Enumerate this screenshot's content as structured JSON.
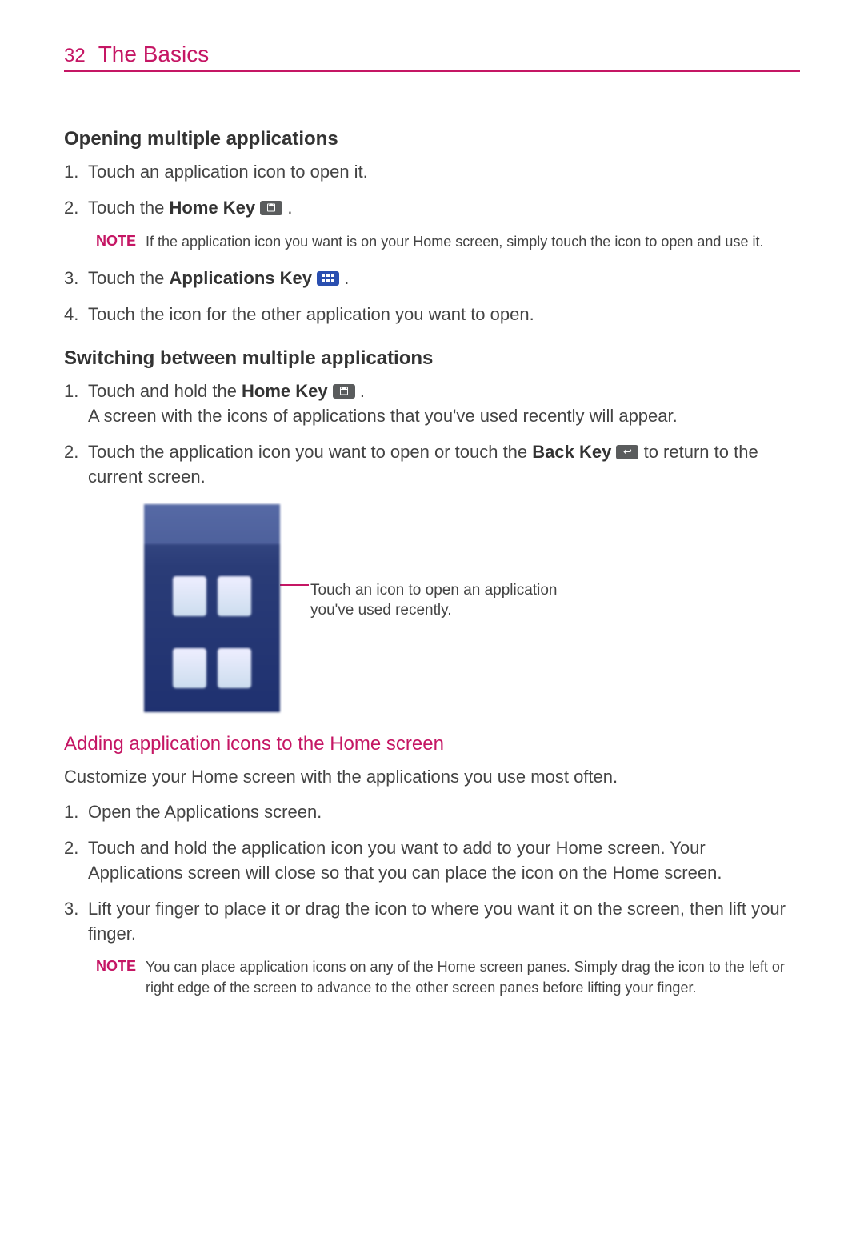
{
  "header": {
    "page_number": "32",
    "chapter": "The Basics"
  },
  "section1": {
    "title": "Opening multiple applications",
    "step1": "Touch an application icon to open it.",
    "step2_pre": "Touch the ",
    "step2_key": "Home Key",
    "step2_post": " .",
    "note_label": "NOTE",
    "note_text": "If the application icon you want is on your Home screen, simply touch the icon to open and use it.",
    "step3_pre": "Touch the ",
    "step3_key": "Applications Key",
    "step3_post": " .",
    "step4": "Touch the icon for the other application you want to open."
  },
  "section2": {
    "title": "Switching between multiple applications",
    "step1_pre": "Touch and hold the ",
    "step1_key": "Home Key",
    "step1_post": " .",
    "step1_line2": "A screen with the icons of applications that you've used recently will appear.",
    "step2_pre": "Touch the application icon you want to open or touch the ",
    "step2_key": "Back Key",
    "step2_post": " to return to the current screen.",
    "callout": "Touch an icon to open an application you've used recently."
  },
  "section3": {
    "title": "Adding application icons to the Home screen",
    "intro": "Customize your Home screen with the applications you use most often.",
    "step1": "Open the Applications screen.",
    "step2": "Touch and hold the application icon you want to add to your Home screen. Your Applications screen will close so that you can place the icon on the Home screen.",
    "step3": "Lift your finger to place it or drag the icon to where you want it on the screen, then lift your finger.",
    "note_label": "NOTE",
    "note_text": "You can place application icons on any of the Home screen panes. Simply drag the icon to the left or right edge of the screen to advance to the other screen panes before lifting your finger."
  },
  "list": {
    "n1": "1.",
    "n2": "2.",
    "n3": "3.",
    "n4": "4."
  }
}
